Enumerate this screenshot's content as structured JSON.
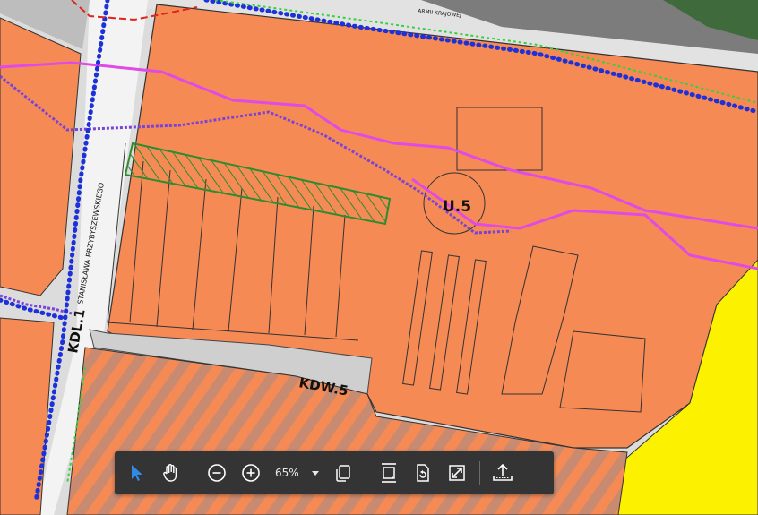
{
  "map": {
    "labels": {
      "street_armii": "ARMII KRAJOWEJ",
      "street_przybyszewskiego": "STANISŁAWA PRZYBYSZEWSKIEGO",
      "kdl": "KDL.1",
      "kdw": "KDW.5",
      "u5": "U.5"
    },
    "colors": {
      "orange_fill": "#f58a55",
      "yellow_fill": "#fcf200",
      "road_gray": "#d8d8d8",
      "magenta_boundary": "#e04ae6",
      "purple_boundary": "#7a42d8",
      "blue_dots": "#1d31d8",
      "green_hatch": "#2e8b2e",
      "red_dash": "#e0231c"
    }
  },
  "toolbar": {
    "zoom_value": "65%",
    "tools": [
      {
        "icon": "cursor-arrow-icon",
        "active": true
      },
      {
        "icon": "hand-pan-icon"
      },
      {
        "icon": "zoom-out-icon"
      },
      {
        "icon": "zoom-in-icon"
      },
      {
        "icon": "page-copy-icon"
      },
      {
        "icon": "fit-width-icon"
      },
      {
        "icon": "rotate-page-icon"
      },
      {
        "icon": "fullscreen-icon"
      },
      {
        "icon": "share-export-icon"
      }
    ]
  }
}
